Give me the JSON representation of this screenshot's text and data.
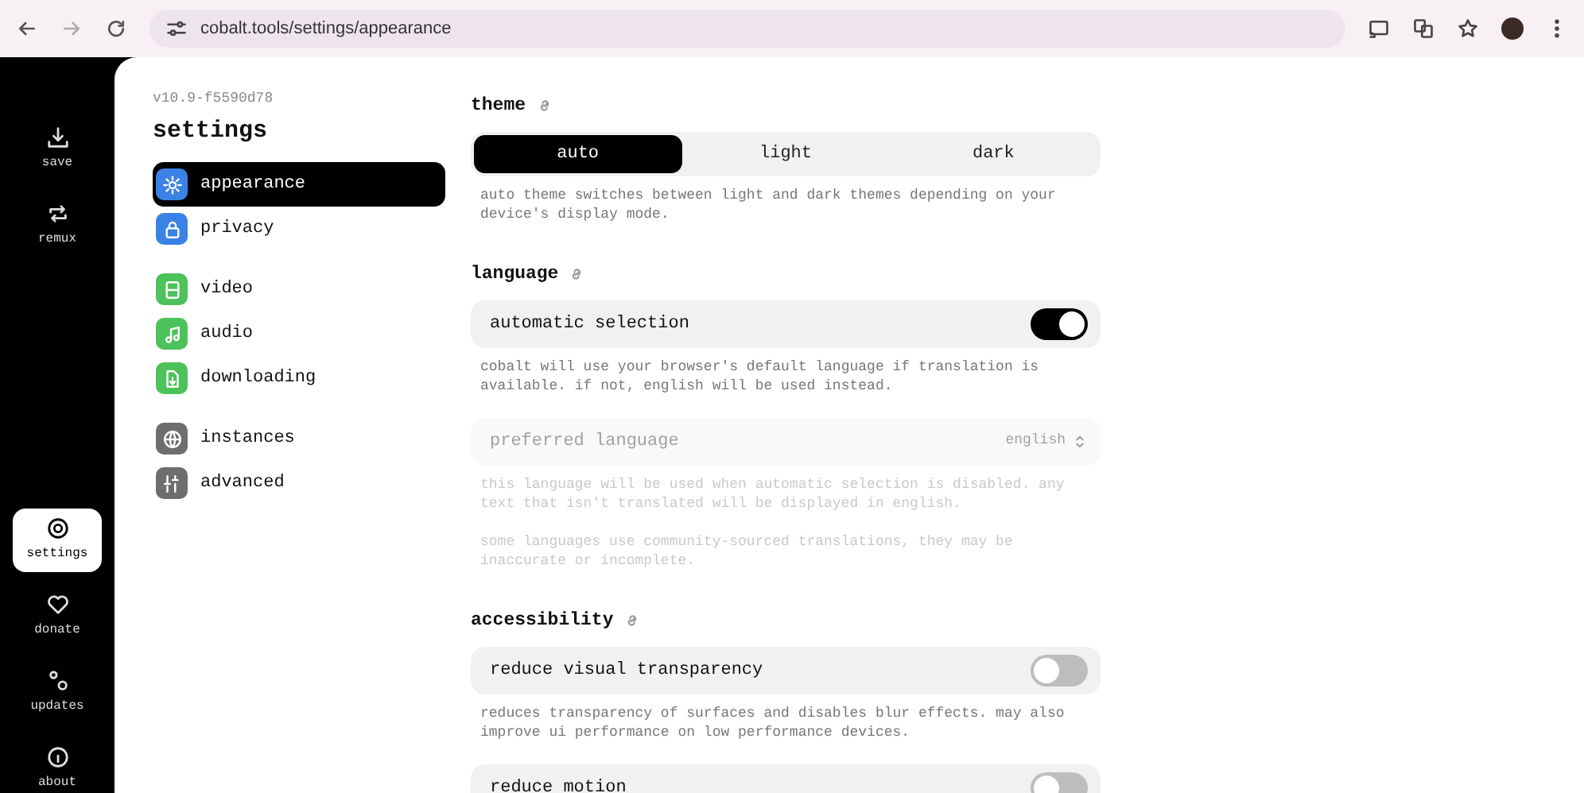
{
  "browser": {
    "url": "cobalt.tools/settings/appearance"
  },
  "sidebar": {
    "items": [
      {
        "label": "save",
        "selected": false
      },
      {
        "label": "remux",
        "selected": false
      },
      {
        "label": "settings",
        "selected": true
      },
      {
        "label": "donate",
        "selected": false
      },
      {
        "label": "updates",
        "selected": false
      },
      {
        "label": "about",
        "selected": false
      }
    ]
  },
  "settings_nav": {
    "version": "v10.9-f5590d78",
    "title": "settings",
    "groups": [
      [
        {
          "label": "appearance",
          "selected": true,
          "color": "#3b82e6"
        },
        {
          "label": "privacy",
          "selected": false,
          "color": "#3b82e6"
        }
      ],
      [
        {
          "label": "video",
          "selected": false,
          "color": "#4cc25a"
        },
        {
          "label": "audio",
          "selected": false,
          "color": "#4cc25a"
        },
        {
          "label": "downloading",
          "selected": false,
          "color": "#4cc25a"
        }
      ],
      [
        {
          "label": "instances",
          "selected": false,
          "color": "#6e6e6e"
        },
        {
          "label": "advanced",
          "selected": false,
          "color": "#6e6e6e"
        }
      ]
    ]
  },
  "sections": [
    {
      "title": "theme",
      "items": [
        {
          "kind": "segmented",
          "options": [
            {
              "label": "auto",
              "selected": true
            },
            {
              "label": "light",
              "selected": false
            },
            {
              "label": "dark",
              "selected": false
            }
          ],
          "description": [
            "auto theme switches between light and dark themes depending on your device's display mode."
          ]
        }
      ]
    },
    {
      "title": "language",
      "items": [
        {
          "kind": "toggle",
          "label": "automatic selection",
          "on": true,
          "disabled": false,
          "description": [
            "cobalt will use your browser's default language if translation is available. if not, english will be used instead."
          ]
        },
        {
          "kind": "select",
          "label": "preferred language",
          "value": "english",
          "disabled": true,
          "description": [
            "this language will be used when automatic selection is disabled. any text that isn't translated will be displayed in english.",
            "some languages use community-sourced translations, they may be inaccurate or incomplete."
          ]
        }
      ]
    },
    {
      "title": "accessibility",
      "items": [
        {
          "kind": "toggle",
          "label": "reduce visual transparency",
          "on": false,
          "disabled": false,
          "description": [
            "reduces transparency of surfaces and disables blur effects. may also improve ui performance on low performance devices."
          ]
        },
        {
          "kind": "toggle",
          "label": "reduce motion",
          "on": false,
          "disabled": false
        }
      ]
    }
  ]
}
